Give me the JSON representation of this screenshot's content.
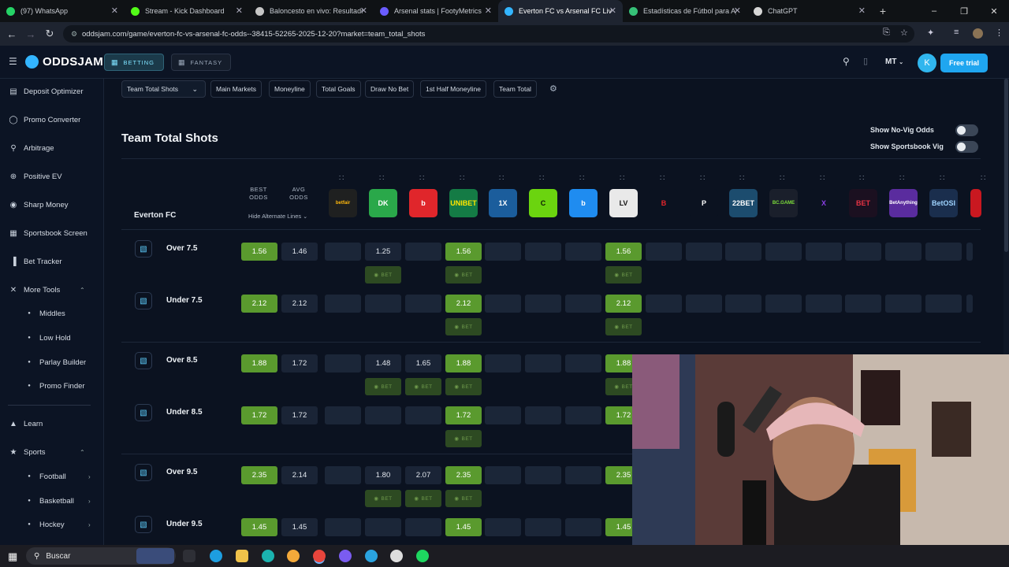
{
  "browser": {
    "tabs": [
      {
        "title": "(97) WhatsApp",
        "color": "#25d366"
      },
      {
        "title": "Stream - Kick Dashboard",
        "color": "#53fc18"
      },
      {
        "title": "Baloncesto en vivo: Resultado",
        "color": "#c6c6c6"
      },
      {
        "title": "Arsenal stats | FootyMetrics",
        "color": "#6a5cff"
      },
      {
        "title": "Everton FC vs Arsenal FC Live C",
        "color": "#33b5ff",
        "active": true
      },
      {
        "title": "Estadísticas de Fútbol para Apu",
        "color": "#36c178"
      },
      {
        "title": "ChatGPT",
        "color": "#d6d6d6"
      }
    ],
    "new_tab": "+",
    "url": "oddsjam.com/game/everton-fc-vs-arsenal-fc-odds--38415-52265-2025-12-20?market=team_total_shots"
  },
  "header": {
    "logo": "ODDSJAM",
    "betting": "BETTING",
    "fantasy": "FANTASY",
    "locale": "MT",
    "avatar": "K",
    "free_trial": "Free trial"
  },
  "sidebar": {
    "items": [
      {
        "label": "Deposit Optimizer",
        "icon": "wallet-icon"
      },
      {
        "label": "Promo Converter",
        "icon": "promo-icon"
      },
      {
        "label": "Arbitrage",
        "icon": "arbitrage-icon"
      },
      {
        "label": "Positive EV",
        "icon": "positive-ev-icon"
      },
      {
        "label": "Sharp Money",
        "icon": "sharp-money-icon"
      },
      {
        "label": "Sportsbook Screen",
        "icon": "grid-icon"
      },
      {
        "label": "Bet Tracker",
        "icon": "chart-icon"
      },
      {
        "label": "More Tools",
        "icon": "tools-icon"
      }
    ],
    "more_tools": [
      "Middles",
      "Low Hold",
      "Parlay Builder",
      "Promo Finder"
    ],
    "learn": "Learn",
    "sports": "Sports",
    "sports_items": [
      "Football",
      "Basketball",
      "Hockey"
    ]
  },
  "markets": [
    "Team Total Shots",
    "Main Markets",
    "Moneyline",
    "Total Goals",
    "Draw No Bet",
    "1st Half Moneyline",
    "Team Total"
  ],
  "page": {
    "title": "Team Total Shots",
    "toggle_novig": "Show No-Vig Odds",
    "toggle_vig": "Show Sportsbook Vig"
  },
  "table": {
    "team": "Everton FC",
    "best_odds": "BEST ODDS",
    "avg_odds": "AVG ODDS",
    "hide_alt": "Hide Alternate Lines",
    "bet_label": "BET",
    "books": [
      {
        "name": "betfair",
        "bg": "#1f2020",
        "fg": "#ffb80c"
      },
      {
        "name": "DK",
        "bg": "#2aa84a",
        "fg": "#ffffff"
      },
      {
        "name": "b",
        "bg": "#e0262b",
        "fg": "#ffffff"
      },
      {
        "name": "UNIBET",
        "bg": "#147b45",
        "fg": "#ffe600"
      },
      {
        "name": "1X",
        "bg": "#1b5d9c",
        "fg": "#ffffff"
      },
      {
        "name": "C",
        "bg": "#6bd40f",
        "fg": "#0b1a05"
      },
      {
        "name": "b",
        "bg": "#1f8cf0",
        "fg": "#ffffff"
      },
      {
        "name": "LV",
        "bg": "#e9e9e9",
        "fg": "#111111"
      },
      {
        "name": "B",
        "bg": "#0b1220",
        "fg": "#e4242a"
      },
      {
        "name": "P",
        "bg": "#0b1220",
        "fg": "#ffffff"
      },
      {
        "name": "22BET",
        "bg": "#1c4c6e",
        "fg": "#ffffff"
      },
      {
        "name": "BC.GAME",
        "bg": "#1a1f2b",
        "fg": "#7cdc3a"
      },
      {
        "name": "X",
        "bg": "#0b1220",
        "fg": "#8a3fe4"
      },
      {
        "name": "BET",
        "bg": "#1b1020",
        "fg": "#e53244"
      },
      {
        "name": "BetAnything",
        "bg": "#5a2c9e",
        "fg": "#ffffff"
      },
      {
        "name": "BetOSI",
        "bg": "#1a2e4d",
        "fg": "#9fd4ff"
      },
      {
        "name": "",
        "bg": "#c91820",
        "fg": "#ffffff"
      }
    ],
    "rows": [
      {
        "name": "Over 7.5",
        "best": "1.56",
        "avg": "1.46",
        "odds": [
          "",
          "1.25",
          "",
          "1.56",
          "",
          "",
          "",
          "1.56"
        ],
        "bet": [
          1,
          3,
          7
        ]
      },
      {
        "name": "Under 7.5",
        "best": "2.12",
        "avg": "2.12",
        "odds": [
          "",
          "",
          "",
          "2.12",
          "",
          "",
          "",
          "2.12"
        ],
        "bet": [
          3,
          7
        ]
      },
      {
        "name": "Over 8.5",
        "best": "1.88",
        "avg": "1.72",
        "odds": [
          "",
          "1.48",
          "1.65",
          "1.88",
          "",
          "",
          "",
          "1.88"
        ],
        "bet": [
          1,
          2,
          3,
          7
        ]
      },
      {
        "name": "Under 8.5",
        "best": "1.72",
        "avg": "1.72",
        "odds": [
          "",
          "",
          "",
          "1.72",
          "",
          "",
          "",
          "1.72"
        ],
        "bet": [
          3
        ]
      },
      {
        "name": "Over 9.5",
        "best": "2.35",
        "avg": "2.14",
        "odds": [
          "",
          "1.80",
          "2.07",
          "2.35",
          "",
          "",
          "",
          "2.35"
        ],
        "bet": [
          1,
          2,
          3
        ]
      },
      {
        "name": "Under 9.5",
        "best": "1.45",
        "avg": "1.45",
        "odds": [
          "",
          "",
          "",
          "1.45",
          "",
          "",
          "",
          "1.45"
        ],
        "bet": []
      }
    ]
  },
  "taskbar": {
    "search": "Buscar"
  }
}
